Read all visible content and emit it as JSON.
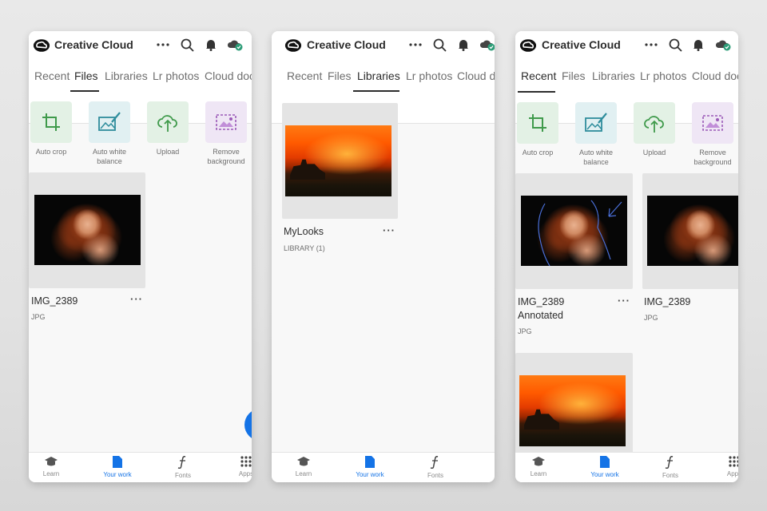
{
  "app": {
    "title": "Creative Cloud"
  },
  "icons": {
    "more": "ellipsis-icon",
    "search": "search-icon",
    "bell": "bell-icon",
    "cloud": "cloud-sync-icon"
  },
  "colors": {
    "accent": "#1473e6",
    "sync": "#2d9d78"
  },
  "tabs": [
    "Recent",
    "Files",
    "Libraries",
    "Lr photos",
    "Cloud docs"
  ],
  "quick_actions": [
    "Auto crop",
    "Auto white balance",
    "Upload",
    "Remove background"
  ],
  "nav": [
    "Learn",
    "Your work",
    "Fonts",
    "Apps"
  ],
  "screens": {
    "files": {
      "active_tab": "Files",
      "items": [
        {
          "name": "IMG_2389",
          "type": "JPG"
        }
      ]
    },
    "libraries": {
      "active_tab": "Libraries",
      "items": [
        {
          "name": "MyLooks",
          "type": "LIBRARY (1)"
        }
      ]
    },
    "recent": {
      "active_tab": "Recent",
      "items": [
        {
          "name_line1": "IMG_2389",
          "name_line2": "Annotated",
          "type": "JPG"
        },
        {
          "name": "IMG_2389",
          "type": "JPG"
        }
      ]
    }
  },
  "more_label": "···"
}
